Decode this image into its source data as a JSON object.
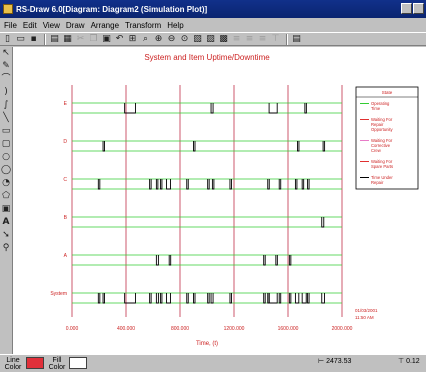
{
  "window": {
    "title": "RS-Draw 6.0[Diagram: Diagram2 (Simulation Plot)]"
  },
  "menu": [
    "File",
    "Edit",
    "View",
    "Draw",
    "Arrange",
    "Transform",
    "Help"
  ],
  "toolbar": {
    "icons": [
      "new-icon",
      "open-icon",
      "save-icon",
      "copy-doc-icon",
      "print-icon",
      "cut-icon",
      "copy-icon",
      "paste-icon",
      "undo-icon",
      "grid-icon",
      "zoom-icon",
      "zoom-in-icon",
      "zoom-out-icon",
      "zoom-fit-icon",
      "page-icon",
      "group-icon",
      "ungroup-icon",
      "align-left-icon",
      "align-center-icon",
      "align-right-icon",
      "align-top-icon",
      "layer-icon"
    ]
  },
  "status": {
    "line_color_label": "Line Color",
    "fill_color_label": "Fill Color",
    "line_color": "#e0303a",
    "fill_color": "#ffffff",
    "x_coord": "2473.53",
    "y_coord": "0.12"
  },
  "chart_data": {
    "type": "line",
    "title": "System and Item Uptime/Downtime",
    "xlabel": "Time, (t)",
    "ylabel": "",
    "xlim": [
      0,
      2000
    ],
    "x_ticks": [
      "0.000",
      "400.000",
      "800.000",
      "1200.000",
      "1600.000",
      "2000.000"
    ],
    "categories": [
      "System",
      "A",
      "B",
      "C",
      "D",
      "E"
    ],
    "timestamp_line1": "01/03/2001",
    "timestamp_line2": "11:50 AM",
    "legend": {
      "title": "State",
      "placement": "right",
      "items": [
        {
          "label": "Operating Time",
          "color": "#33cc33"
        },
        {
          "label": "Waiting For Repair Opportunity",
          "color": "#e03030"
        },
        {
          "label": "Waiting For Corrective Crew",
          "color": "#e87cc8"
        },
        {
          "label": "Waiting For Spare Parts",
          "color": "#e03030"
        },
        {
          "label": "Time Under Repair",
          "color": "#000000"
        }
      ]
    },
    "colors": {
      "grid_vertical": "#c0304a",
      "grid_horizontal": "#33cc33",
      "downtime": "#000000",
      "title": "#cc2222"
    },
    "series": [
      {
        "name": "E",
        "downtimes": [
          [
            390,
            470
          ],
          [
            1030,
            1045
          ],
          [
            1460,
            1520
          ],
          [
            1725,
            1735
          ]
        ]
      },
      {
        "name": "D",
        "downtimes": [
          [
            230,
            240
          ],
          [
            900,
            910
          ],
          [
            1670,
            1680
          ],
          [
            1860,
            1870
          ]
        ]
      },
      {
        "name": "C",
        "downtimes": [
          [
            195,
            200
          ],
          [
            575,
            580
          ],
          [
            625,
            630
          ],
          [
            655,
            660
          ],
          [
            700,
            730
          ],
          [
            850,
            860
          ],
          [
            1005,
            1010
          ],
          [
            1040,
            1045
          ],
          [
            1170,
            1175
          ],
          [
            1450,
            1460
          ],
          [
            1535,
            1540
          ],
          [
            1655,
            1665
          ],
          [
            1705,
            1715
          ],
          [
            1745,
            1755
          ]
        ]
      },
      {
        "name": "B",
        "downtimes": [
          [
            1850,
            1865
          ]
        ]
      },
      {
        "name": "A",
        "downtimes": [
          [
            625,
            640
          ],
          [
            720,
            730
          ],
          [
            1420,
            1430
          ],
          [
            1510,
            1515
          ],
          [
            1610,
            1620
          ]
        ]
      },
      {
        "name": "System",
        "downtimes": [
          [
            195,
            200
          ],
          [
            230,
            240
          ],
          [
            390,
            470
          ],
          [
            575,
            580
          ],
          [
            625,
            640
          ],
          [
            655,
            660
          ],
          [
            700,
            730
          ],
          [
            850,
            860
          ],
          [
            900,
            910
          ],
          [
            1005,
            1010
          ],
          [
            1030,
            1045
          ],
          [
            1170,
            1175
          ],
          [
            1420,
            1430
          ],
          [
            1450,
            1460
          ],
          [
            1460,
            1520
          ],
          [
            1535,
            1540
          ],
          [
            1610,
            1620
          ],
          [
            1655,
            1680
          ],
          [
            1705,
            1735
          ],
          [
            1745,
            1755
          ],
          [
            1850,
            1870
          ]
        ]
      }
    ]
  }
}
